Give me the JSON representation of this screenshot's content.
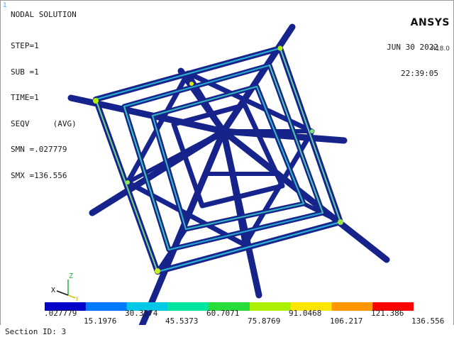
{
  "window_index": "1",
  "plot_title": "NODAL SOLUTION",
  "solution_info": [
    "STEP=1",
    "SUB =1",
    "TIME=1",
    "SEQV     (AVG)",
    "SMN =.027779",
    "SMX =136.556"
  ],
  "brand": {
    "name": "ANSYS",
    "version": "R18.0"
  },
  "date": "JUN 30 2022",
  "time": "22:39:05",
  "triad": {
    "x_label": "X",
    "y_label": "Y",
    "z_label": "Z"
  },
  "legend": {
    "colors": [
      "#0000c8",
      "#0078ff",
      "#00c8e6",
      "#00e6a0",
      "#28dc3c",
      "#aaf000",
      "#ffe600",
      "#ff9600",
      "#ff0000"
    ],
    "top_labels": [
      ".027779",
      "30.3574",
      "60.7071",
      "91.0468",
      "121.386"
    ],
    "bottom_labels": [
      "15.1976",
      "45.5373",
      "75.8769",
      "106.217",
      "136.556"
    ]
  },
  "footer": {
    "section_label": "Section ID: 3"
  },
  "icons": [
    "coordinate-triad-icon"
  ]
}
